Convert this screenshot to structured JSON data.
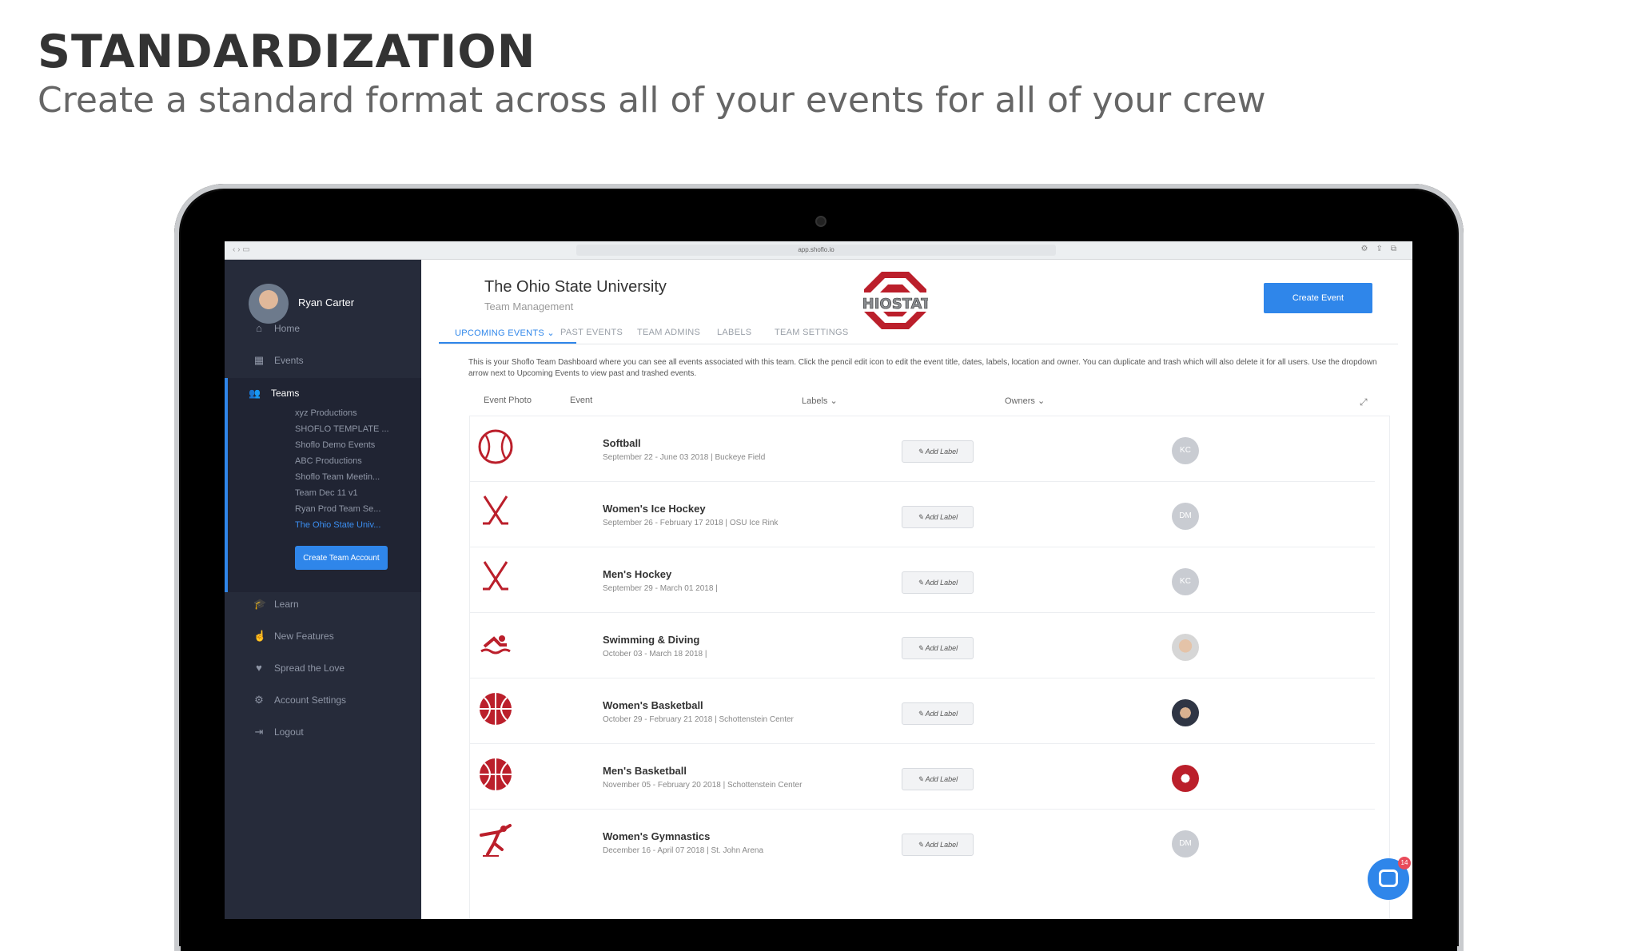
{
  "slide": {
    "title": "STANDARDIZATION",
    "subtitle": "Create a standard format across all of your events for all of your crew"
  },
  "browser": {
    "url": "app.shoflo.io"
  },
  "sidebar": {
    "user_name": "Ryan Carter",
    "nav_top": [
      {
        "label": "Home",
        "icon": "home-icon"
      },
      {
        "label": "Events",
        "icon": "calendar-icon"
      }
    ],
    "teams": {
      "label": "Teams",
      "icon": "users-icon",
      "items": [
        "xyz Productions",
        "SHOFLO TEMPLATE ...",
        "Shoflo Demo Events",
        "ABC Productions",
        "Shoflo Team Meetin...",
        "Team Dec 11 v1",
        "Ryan Prod Team Se...",
        "The Ohio State Univ..."
      ],
      "create_button": "Create Team Account"
    },
    "nav_bottom": [
      {
        "label": "Learn",
        "icon": "graduation-cap-icon"
      },
      {
        "label": "New Features",
        "icon": "hand-pointer-icon"
      },
      {
        "label": "Spread the Love",
        "icon": "heart-icon"
      },
      {
        "label": "Account Settings",
        "icon": "gear-icon"
      },
      {
        "label": "Logout",
        "icon": "logout-icon"
      }
    ]
  },
  "header": {
    "title": "The Ohio State University",
    "subtitle": "Team Management",
    "create_event": "Create Event",
    "colors": {
      "scarlet": "#bb1f2b",
      "gray": "#8a8d91",
      "accent": "#2f86ea"
    }
  },
  "tabs": [
    {
      "label": "UPCOMING EVENTS ⌄",
      "active": true
    },
    {
      "label": "PAST EVENTS"
    },
    {
      "label": "TEAM ADMINS"
    },
    {
      "label": "LABELS"
    },
    {
      "label": "TEAM SETTINGS"
    }
  ],
  "description": "This is your Shoflo Team Dashboard where you can see all events associated with this team. Click the pencil edit icon to edit the event title, dates, labels, location and owner. You can duplicate and trash which will also delete it for all users. Use the dropdown arrow next to Upcoming Events to view past and trashed events.",
  "table": {
    "headers": {
      "photo": "Event Photo",
      "event": "Event",
      "labels": "Labels ⌄",
      "owners": "Owners ⌄"
    },
    "add_label": "Add Label",
    "rows": [
      {
        "name": "Softball",
        "dates": "September 22 - June 03 2018",
        "location": "Buckeye Field",
        "owner": "KC",
        "icon": "baseball-icon"
      },
      {
        "name": "Women's Ice Hockey",
        "dates": "September 26 - February 17 2018",
        "location": "OSU Ice Rink",
        "owner": "DM",
        "icon": "hockey-sticks-icon"
      },
      {
        "name": "Men's Hockey",
        "dates": "September 29 - March 01 2018",
        "location": "",
        "owner": "KC",
        "icon": "hockey-sticks-icon"
      },
      {
        "name": "Swimming & Diving",
        "dates": "October 03 - March 18 2018",
        "location": "",
        "owner": "",
        "icon": "swimmer-icon"
      },
      {
        "name": "Women's Basketball",
        "dates": "October 29 - February 21 2018",
        "location": "Schottenstein Center",
        "owner": "",
        "icon": "basketball-icon"
      },
      {
        "name": "Men's Basketball",
        "dates": "November 05 - February 20 2018",
        "location": "Schottenstein Center",
        "owner": "",
        "icon": "basketball-icon"
      },
      {
        "name": "Women's Gymnastics",
        "dates": "December 16 - April 07 2018",
        "location": "St. John Arena",
        "owner": "DM",
        "icon": "gymnast-icon"
      }
    ]
  },
  "chat": {
    "badge": "14"
  }
}
